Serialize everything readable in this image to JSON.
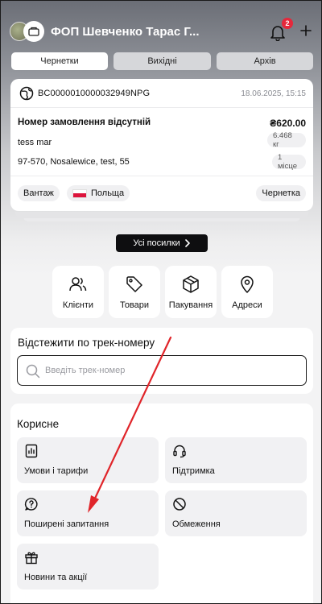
{
  "header": {
    "shop_name": "ФОП Шевченко Тарас Г...",
    "notification_count": "2"
  },
  "tabs": [
    {
      "label": "Чернетки",
      "active": true
    },
    {
      "label": "Вихідні",
      "active": false
    },
    {
      "label": "Архів",
      "active": false
    }
  ],
  "parcel": {
    "tracking_number": "BC0000010000032949NPG",
    "date": "18.06.2025, 15:15",
    "order_status": "Номер замовлення відсутній",
    "price": "₴620.00",
    "recipient": "tess mar",
    "weight": "6.468 кг",
    "address": "97-570, Nosalewice, test, 55",
    "places": "1 місце",
    "type_chip": "Вантаж",
    "country_chip": "Польща",
    "status_chip": "Чернетка"
  },
  "all_parcels_label": "Усі посилки",
  "quick_actions": [
    {
      "label": "Клієнти",
      "icon": "users-icon"
    },
    {
      "label": "Товари",
      "icon": "tag-icon"
    },
    {
      "label": "Пакування",
      "icon": "box-icon"
    },
    {
      "label": "Адреси",
      "icon": "map-pin-icon"
    }
  ],
  "tracking": {
    "title": "Відстежити по трек-номеру",
    "placeholder": "Введіть трек-номер"
  },
  "useful": {
    "title": "Корисне",
    "items": [
      {
        "label": "Умови і тарифи",
        "icon": "chart-doc-icon"
      },
      {
        "label": "Підтримка",
        "icon": "headset-icon"
      },
      {
        "label": "Поширені запитання",
        "icon": "question-bubble-icon"
      },
      {
        "label": "Обмеження",
        "icon": "prohibited-icon"
      },
      {
        "label": "Новини та акції",
        "icon": "gift-icon"
      }
    ]
  },
  "colors": {
    "accent_dark": "#0e0e10",
    "badge_red": "#e5283b",
    "annotation_red": "#e0252a"
  }
}
